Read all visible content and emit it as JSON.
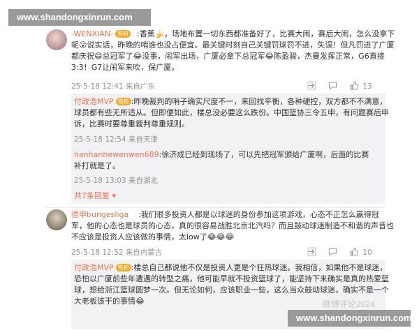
{
  "watermark": {
    "top": "www.shandongxinrun.com",
    "bottom": "www.shandongxinrun.com"
  },
  "comments": [
    {
      "user": "-WENXIAN-",
      "badge": "铁粉",
      "lines": [
        ":香蕉🍌，场地布置一切东西都准备好了，比赛大闹，赛后大闹，怎么没拿下",
        "呢😮说实话，昨晚的哨谁也没占便宜。最关键时刻自己关键罚球罚不进，失误！但凡罚进了广厦",
        "都庆祝😄总冠军了😂没事，闹军出场，广厦必拿下总冠军😂陈盈骏，杰曼发挥正常，G6直接",
        "3:3！G7让闹军来吹，保广厦。"
      ],
      "time": "25-5-18 12:41 来自广东",
      "like_count": "13",
      "icon_share": "share-icon",
      "icon_comment": "comment-icon",
      "icon_like": "like-icon",
      "replies": [
        {
          "user": "付政浩MVP",
          "badge": "铁粉",
          "lines": [
            ":昨晚裁判的哨子确实尺度不一，来回找平衡，各种硬控，双方都不不满意，",
            "球员都有些无所适从。但即便如此，楼总没必要这么跌份。中国篮协三令五申，有问题赛后申",
            "诉，比赛时要尊重裁判尊重规则。"
          ],
          "time": "25-5-18 12:54 来自天津"
        },
        {
          "user": "hanhanhewenwen689",
          "lines": [
            ":徐济成已经到现场了，可以先把冠军颁给广厦啊，后面的比赛",
            "补打就是了。"
          ],
          "time": "25-5-18 13:03 来自湖北"
        }
      ],
      "more_replies": "共7条回复 ▾"
    },
    {
      "user": "德甲bungesliga",
      "lines": [
        ":我们很多投资人都是以球迷的身份参加这项游戏，心态不正怎么赢得冠",
        "军，他的心态也是球员的心态，真的很容易战胜北京北汽吗？而且鼓动球迷制造不和谐的声音也",
        "不应该是投资人应该做的事情，太low了😂😂😂"
      ],
      "time": "25-5-18 12:52 来自内蒙古",
      "like_count": "10",
      "icon_share": "share-icon",
      "icon_comment": "comment-icon",
      "icon_like": "like-icon",
      "replies": [
        {
          "user": "付政浩MVP",
          "badge": "铁粉",
          "lines": [
            ":楼总自己都说他不仅是投资人更是个狂热球迷。我相信，如果他不是球迷，",
            "恐怕以广厦前些年遭遇的转型之痛，他可能早就不投资篮球了，能坚持下来确实是真的热爱篮",
            "球，想给浙江篮球圆梦一次。但无论如何，应该职业一些，这么当众鼓动球迷，确实不是一个",
            "大老板该干的事情😂"
          ]
        }
      ]
    }
  ],
  "weibo_watermark": "微博评论2024"
}
